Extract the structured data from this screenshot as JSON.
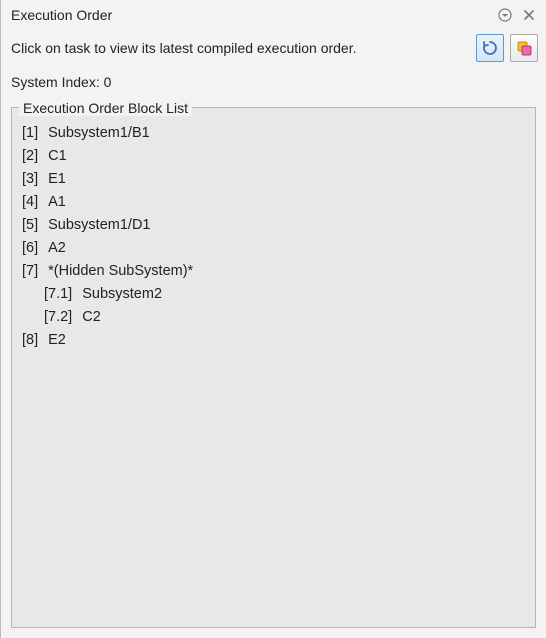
{
  "titlebar": {
    "title": "Execution Order"
  },
  "instruction": "Click on task to view its latest compiled execution order.",
  "system_index_label": "System Index: ",
  "system_index_value": "0",
  "group_label": "Execution Order Block List",
  "list": [
    {
      "index": "[1]",
      "name": "Subsystem1/B1",
      "indent": 0
    },
    {
      "index": "[2]",
      "name": "C1",
      "indent": 0
    },
    {
      "index": "[3]",
      "name": "E1",
      "indent": 0
    },
    {
      "index": "[4]",
      "name": "A1",
      "indent": 0
    },
    {
      "index": "[5]",
      "name": "Subsystem1/D1",
      "indent": 0
    },
    {
      "index": "[6]",
      "name": "A2",
      "indent": 0
    },
    {
      "index": "[7]",
      "name": "*(Hidden SubSystem)*",
      "indent": 0
    },
    {
      "index": "[7.1]",
      "name": "Subsystem2",
      "indent": 1
    },
    {
      "index": "[7.2]",
      "name": "C2",
      "indent": 1
    },
    {
      "index": "[8]",
      "name": "E2",
      "indent": 0
    }
  ]
}
